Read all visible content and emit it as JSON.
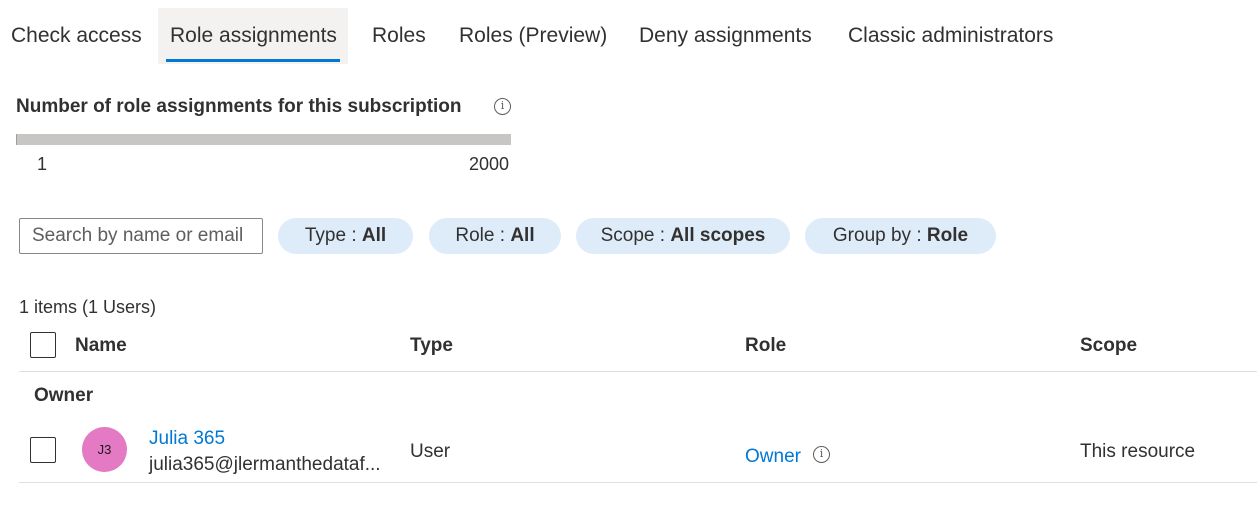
{
  "tabs": [
    {
      "label": "Check access"
    },
    {
      "label": "Role assignments",
      "active": true
    },
    {
      "label": "Roles"
    },
    {
      "label": "Roles (Preview)"
    },
    {
      "label": "Deny assignments"
    },
    {
      "label": "Classic administrators"
    }
  ],
  "limits": {
    "title": "Number of role assignments for this subscription",
    "info_glyph": "i",
    "min_label": "1",
    "max_label": "2000",
    "used_fraction": 0.0005
  },
  "filters": {
    "search_placeholder": "Search by name or email",
    "type": {
      "label": "Type : ",
      "value": "All"
    },
    "role": {
      "label": "Role : ",
      "value": "All"
    },
    "scope": {
      "label": "Scope : ",
      "value": "All scopes"
    },
    "group_by": {
      "label": "Group by : ",
      "value": "Role"
    }
  },
  "summary": "1 items (1 Users)",
  "table": {
    "headers": {
      "name": "Name",
      "type": "Type",
      "role": "Role",
      "scope": "Scope"
    },
    "groups": [
      {
        "label": "Owner",
        "rows": [
          {
            "avatar_initials": "J3",
            "name": "Julia 365",
            "email": "julia365@jlermanthedataf...",
            "type": "User",
            "role": "Owner",
            "scope": "This resource"
          }
        ]
      }
    ]
  },
  "colors": {
    "accent": "#0078d4",
    "pill_bg": "#deecf9",
    "avatar_bg": "#e37ac3"
  },
  "icons": {
    "info": "info-icon"
  }
}
